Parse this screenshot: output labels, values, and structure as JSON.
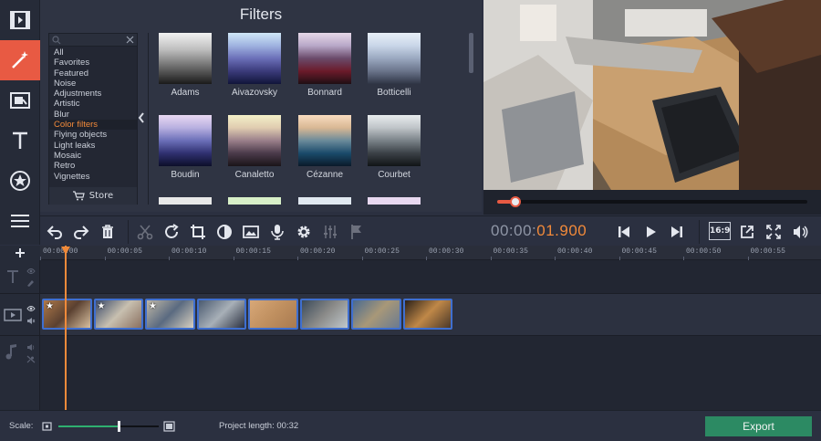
{
  "panel": {
    "title": "Filters",
    "categories": [
      "All",
      "Favorites",
      "Featured",
      "Noise",
      "Adjustments",
      "Artistic",
      "Blur",
      "Color filters",
      "Flying objects",
      "Light leaks",
      "Mosaic",
      "Retro",
      "Vignettes"
    ],
    "active_category": "Color filters",
    "store_label": "Store"
  },
  "filters": [
    {
      "name": "Adams",
      "colors": [
        "#f2f2f2",
        "#bdbdbd",
        "#6b6b6b",
        "#1a1a1a"
      ]
    },
    {
      "name": "Aivazovsky",
      "colors": [
        "#cfe7f7",
        "#9fb3e0",
        "#6b6fb8",
        "#3a3a7a",
        "#10153a"
      ]
    },
    {
      "name": "Bonnard",
      "colors": [
        "#e6d8e8",
        "#b8a8c8",
        "#6a4a6a",
        "#6b1a2a",
        "#1f0f14"
      ]
    },
    {
      "name": "Botticelli",
      "colors": [
        "#e8eff7",
        "#c9d6e8",
        "#9aa8c0",
        "#6a748a",
        "#2f3545"
      ]
    },
    {
      "name": "Boudin",
      "colors": [
        "#e8d8f2",
        "#b8b0e0",
        "#6b6fb8",
        "#2f3070",
        "#0c0e2a"
      ]
    },
    {
      "name": "Canaletto",
      "colors": [
        "#f3f0c8",
        "#e0ccb0",
        "#9a7f8a",
        "#4a3a4a",
        "#1a1418"
      ]
    },
    {
      "name": "Cézanne",
      "colors": [
        "#f8dcc0",
        "#d9b894",
        "#6a8a9a",
        "#1a4a6a",
        "#0a1a2a"
      ]
    },
    {
      "name": "Courbet",
      "colors": [
        "#e8ecee",
        "#bfc4c8",
        "#7a8288",
        "#3a4046",
        "#101416"
      ]
    }
  ],
  "toolbar": {
    "timecode_dim": "00:00:",
    "timecode_hi": "01.900",
    "aspect_label": "16:9"
  },
  "timeline": {
    "ticks": [
      "00:00:00",
      "00:00:05",
      "00:00:10",
      "00:00:15",
      "00:00:20",
      "00:00:25",
      "00:00:30",
      "00:00:35",
      "00:00:40",
      "00:00:45",
      "00:00:50",
      "00:00:55"
    ]
  },
  "clips": [
    {
      "starred": true,
      "tone": [
        "#b07a4a",
        "#5a4030",
        "#d8c0a0"
      ]
    },
    {
      "starred": true,
      "tone": [
        "#3a4a6a",
        "#c8c0b0",
        "#8a7060"
      ]
    },
    {
      "starred": true,
      "tone": [
        "#c0b8a8",
        "#5a6a80",
        "#d8d0c0"
      ]
    },
    {
      "starred": false,
      "tone": [
        "#4a5a70",
        "#a8b0b8",
        "#2a3040"
      ]
    },
    {
      "starred": false,
      "tone": [
        "#d8a878",
        "#c09060",
        "#a87a50"
      ]
    },
    {
      "starred": false,
      "tone": [
        "#3a4a5a",
        "#8a8a88",
        "#c0c8cc"
      ]
    },
    {
      "starred": false,
      "tone": [
        "#4a6a90",
        "#a89878",
        "#6a7a90"
      ]
    },
    {
      "starred": false,
      "tone": [
        "#2a2018",
        "#c08848",
        "#4a3828"
      ]
    }
  ],
  "bottom": {
    "scale_label": "Scale:",
    "scale_value": 0.6,
    "project_length_label": "Project length:",
    "project_length": "00:32",
    "export_label": "Export"
  },
  "preview": {
    "progress": 0.06
  },
  "colors": {
    "accent": "#e85a43",
    "timecode_accent": "#f28a3a",
    "clip_border": "#3f6fd0",
    "export": "#2c8a63"
  }
}
